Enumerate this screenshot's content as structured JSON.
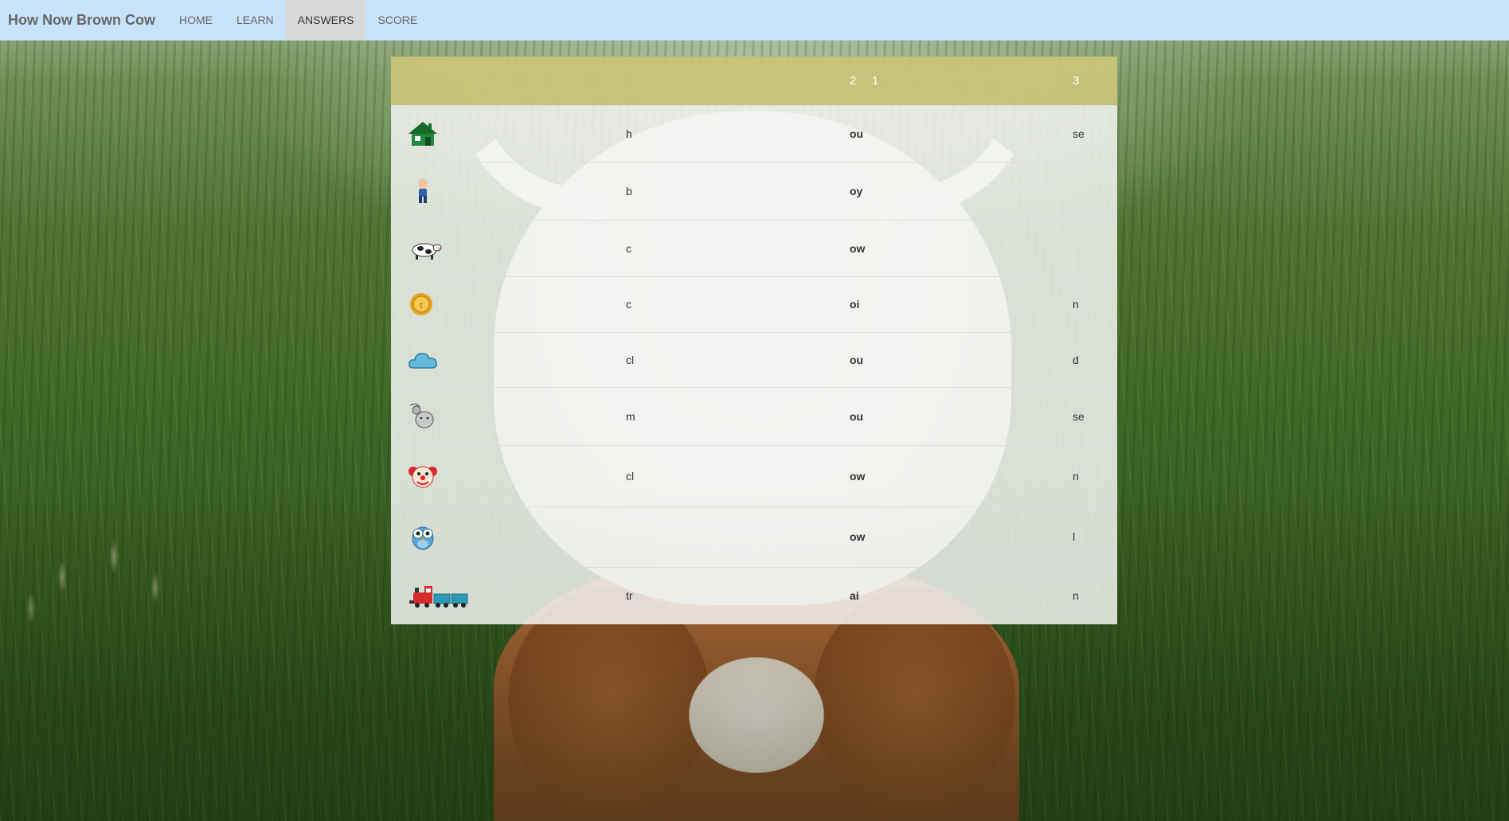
{
  "app": {
    "brand": "How Now Brown Cow"
  },
  "nav": {
    "items": [
      {
        "label": "HOME",
        "active": false
      },
      {
        "label": "LEARN",
        "active": false
      },
      {
        "label": "ANSWERS",
        "active": true
      },
      {
        "label": "SCORE",
        "active": false
      }
    ]
  },
  "table": {
    "headers": [
      "",
      "1",
      "2",
      "3"
    ],
    "rows": [
      {
        "icon": "house-icon",
        "c1": "h",
        "c2": "ou",
        "c3": "se"
      },
      {
        "icon": "boy-icon",
        "c1": "b",
        "c2": "oy",
        "c3": ""
      },
      {
        "icon": "cow-icon",
        "c1": "c",
        "c2": "ow",
        "c3": ""
      },
      {
        "icon": "coin-icon",
        "c1": "c",
        "c2": "oi",
        "c3": "n"
      },
      {
        "icon": "cloud-icon",
        "c1": "cl",
        "c2": "ou",
        "c3": "d"
      },
      {
        "icon": "mouse-icon",
        "c1": "m",
        "c2": "ou",
        "c3": "se"
      },
      {
        "icon": "clown-icon",
        "c1": "cl",
        "c2": "ow",
        "c3": "n"
      },
      {
        "icon": "owl-icon",
        "c1": "",
        "c2": "ow",
        "c3": "l"
      },
      {
        "icon": "train-icon",
        "c1": "tr",
        "c2": "ai",
        "c3": "n"
      }
    ]
  },
  "colors": {
    "navbar": "#c8e2fb",
    "header_row": "#c8c478",
    "active_tab": "#d9d9d9"
  }
}
